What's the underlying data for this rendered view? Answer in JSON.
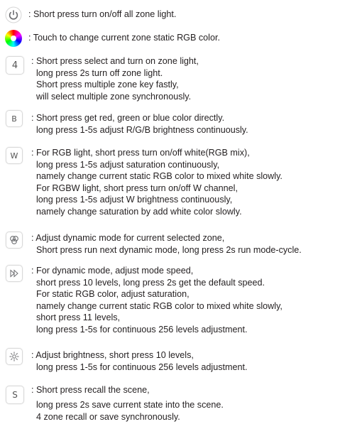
{
  "entries": [
    {
      "id": "power",
      "icon": "power-icon",
      "key_label": "",
      "lines": [
        ": Short press turn on/off all zone light."
      ]
    },
    {
      "id": "color-wheel",
      "icon": "color-wheel-icon",
      "key_label": "",
      "lines": [
        ": Touch to change current zone static RGB color."
      ]
    },
    {
      "id": "zone",
      "icon": "zone-key",
      "key_label": "4",
      "lines": [
        ": Short press select and turn on zone light,",
        "long press 2s turn off zone light.",
        "Short press multiple zone key fastly,",
        "will select multiple zone synchronously."
      ]
    },
    {
      "id": "b-key",
      "icon": "letter-key",
      "key_label": "B",
      "lines": [
        ": Short press get red, green or blue color directly.",
        "long press 1-5s adjust R/G/B brightness continuously."
      ]
    },
    {
      "id": "w-key",
      "icon": "letter-key",
      "key_label": "W",
      "lines": [
        ": For RGB light, short press turn on/off white(RGB mix),",
        "long press 1-5s adjust saturation continuously,",
        "namely change current static RGB color to mixed white slowly.",
        "For RGBW light, short press turn on/off W channel,",
        "long press 1-5s adjust W brightness continuously,",
        "namely change saturation by add white color slowly."
      ]
    },
    {
      "id": "mode",
      "icon": "mode-icon",
      "key_label": "",
      "lines": [
        ": Adjust dynamic mode for current selected zone,",
        "Short press run next dynamic mode, long press 2s run mode-cycle."
      ]
    },
    {
      "id": "speed",
      "icon": "speed-icon",
      "key_label": "",
      "lines": [
        ": For dynamic mode, adjust mode speed,",
        "short press 10 levels, long press 2s get the default speed.",
        "For static RGB color, adjust saturation,",
        "namely change current static RGB color to mixed white slowly,",
        "short press 11 levels,",
        "long press 1-5s for continuous 256 levels adjustment."
      ]
    },
    {
      "id": "brightness",
      "icon": "brightness-icon",
      "key_label": "",
      "lines": [
        ": Adjust brightness, short press 10 levels,",
        "long press 1-5s for continuous 256 levels adjustment."
      ]
    },
    {
      "id": "scene",
      "icon": "letter-key",
      "key_label": "S",
      "lines": [
        ": Short press recall the scene,",
        "long press 2s save current state into the scene.",
        "4 zone recall or save synchronously."
      ]
    }
  ]
}
